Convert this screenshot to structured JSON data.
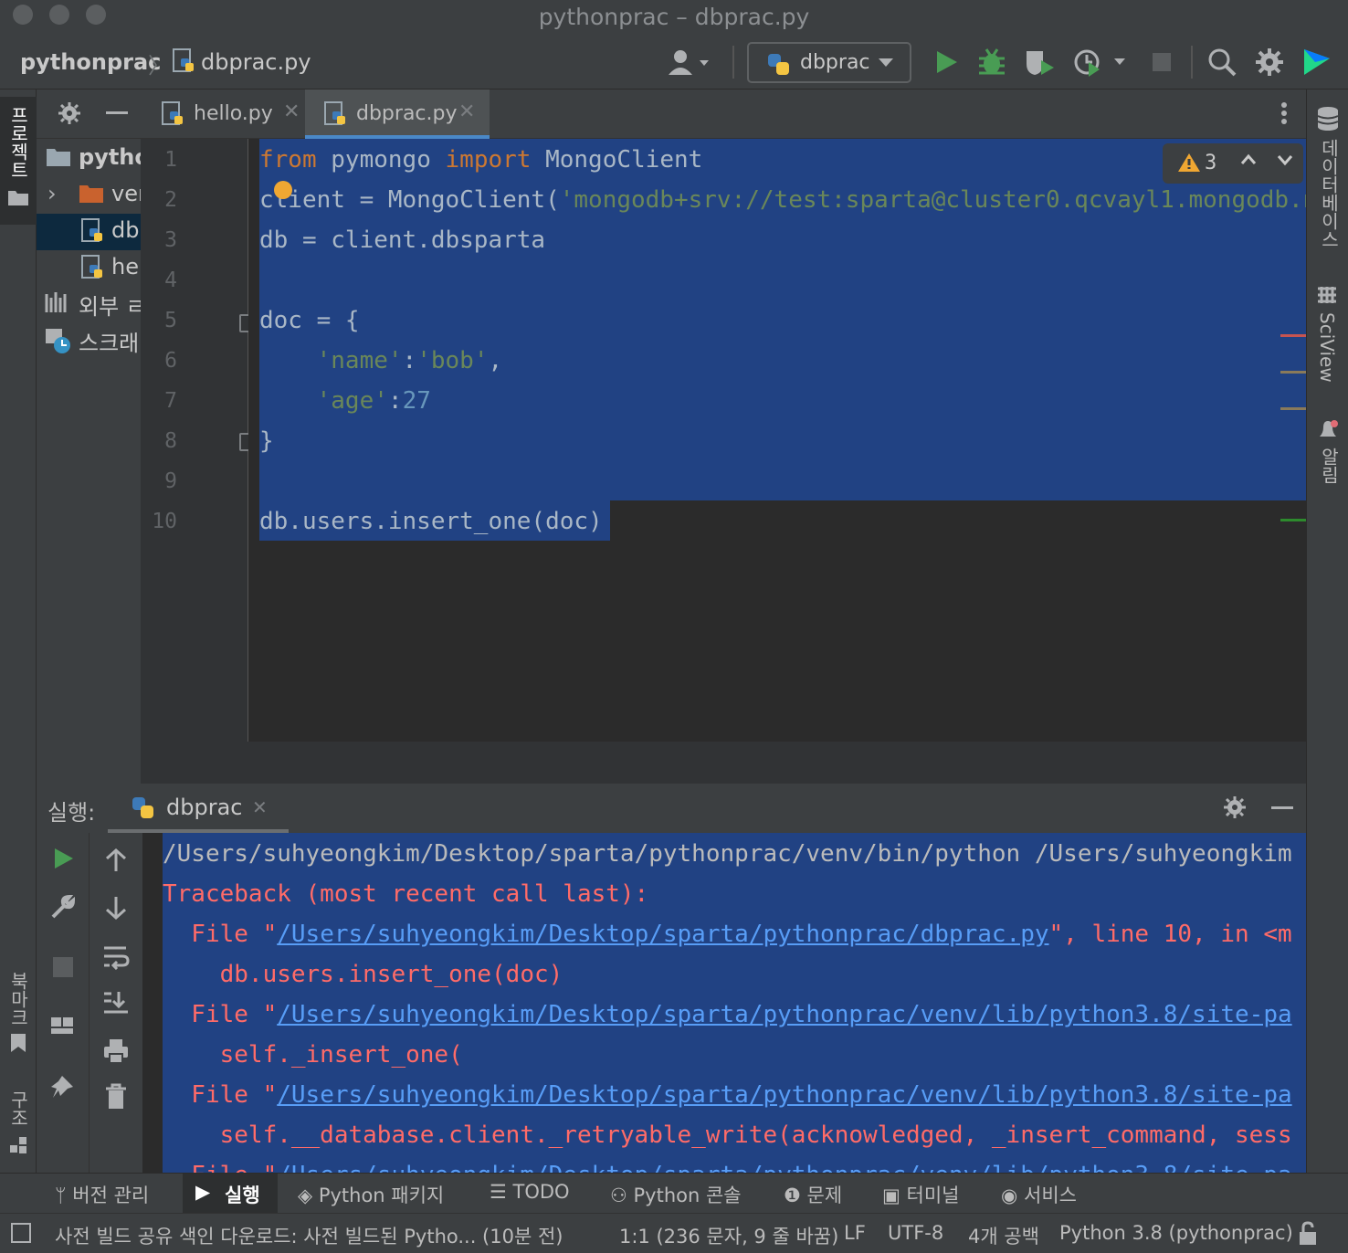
{
  "window": {
    "title": "pythonprac – dbprac.py"
  },
  "breadcrumb": {
    "project": "pythonprac",
    "file": "dbprac.py"
  },
  "toolbar": {
    "run_config": "dbprac"
  },
  "project_tree": {
    "items": [
      {
        "label": "pytho"
      },
      {
        "label": "ver"
      },
      {
        "label": "db"
      },
      {
        "label": "hel"
      },
      {
        "label": "외부 ㄹ"
      },
      {
        "label": "스크래"
      }
    ]
  },
  "left_strip": {
    "project_label": "프로젝트",
    "bookmarks_label": "북마크",
    "structure_label": "구조"
  },
  "right_strip": {
    "database_label": "데이터베이스",
    "sciview_label": "SciView",
    "notifications_label": "알림"
  },
  "tabs": [
    {
      "label": "hello.py"
    },
    {
      "label": "dbprac.py"
    }
  ],
  "editor": {
    "warning_count": "3",
    "line_numbers": [
      "1",
      "2",
      "3",
      "4",
      "5",
      "6",
      "7",
      "8",
      "9",
      "10"
    ]
  },
  "run": {
    "label": "실행:",
    "tab": "dbprac",
    "console": [
      "/Users/suhyeongkim/Desktop/sparta/pythonprac/venv/bin/python /Users/suhyeongkim",
      "Traceback (most recent call last):",
      "  File \"",
      "/Users/suhyeongkim/Desktop/sparta/pythonprac/dbprac.py",
      "\", line 10, in <m",
      "    db.users.insert_one(doc)",
      "/Users/suhyeongkim/Desktop/sparta/pythonprac/venv/lib/python3.8/site-pa",
      "    self._insert_one(",
      "    self.__database.client._retryable_write(acknowledged, _insert_command, sess"
    ]
  },
  "bottom_tools": [
    {
      "label": "버전 관리"
    },
    {
      "label": "실행"
    },
    {
      "label": "Python 패키지"
    },
    {
      "label": "TODO"
    },
    {
      "label": "Python 콘솔"
    },
    {
      "label": "문제"
    },
    {
      "label": "터미널"
    },
    {
      "label": "서비스"
    }
  ],
  "status": {
    "message": "사전 빌드 공유 색인 다운로드: 사전 빌드된 Pytho... (10분 전)",
    "position": "1:1 (236 문자, 9 줄 바꿈)",
    "line_sep": "LF",
    "encoding": "UTF-8",
    "indent": "4개 공백",
    "interpreter": "Python 3.8 (pythonprac)"
  },
  "colors": {
    "selection": "#214283",
    "keyword": "#cc7832",
    "string": "#6a8759",
    "number": "#6897bb",
    "error": "#ff6b68",
    "link": "#589df6",
    "run_green": "#499c54"
  }
}
